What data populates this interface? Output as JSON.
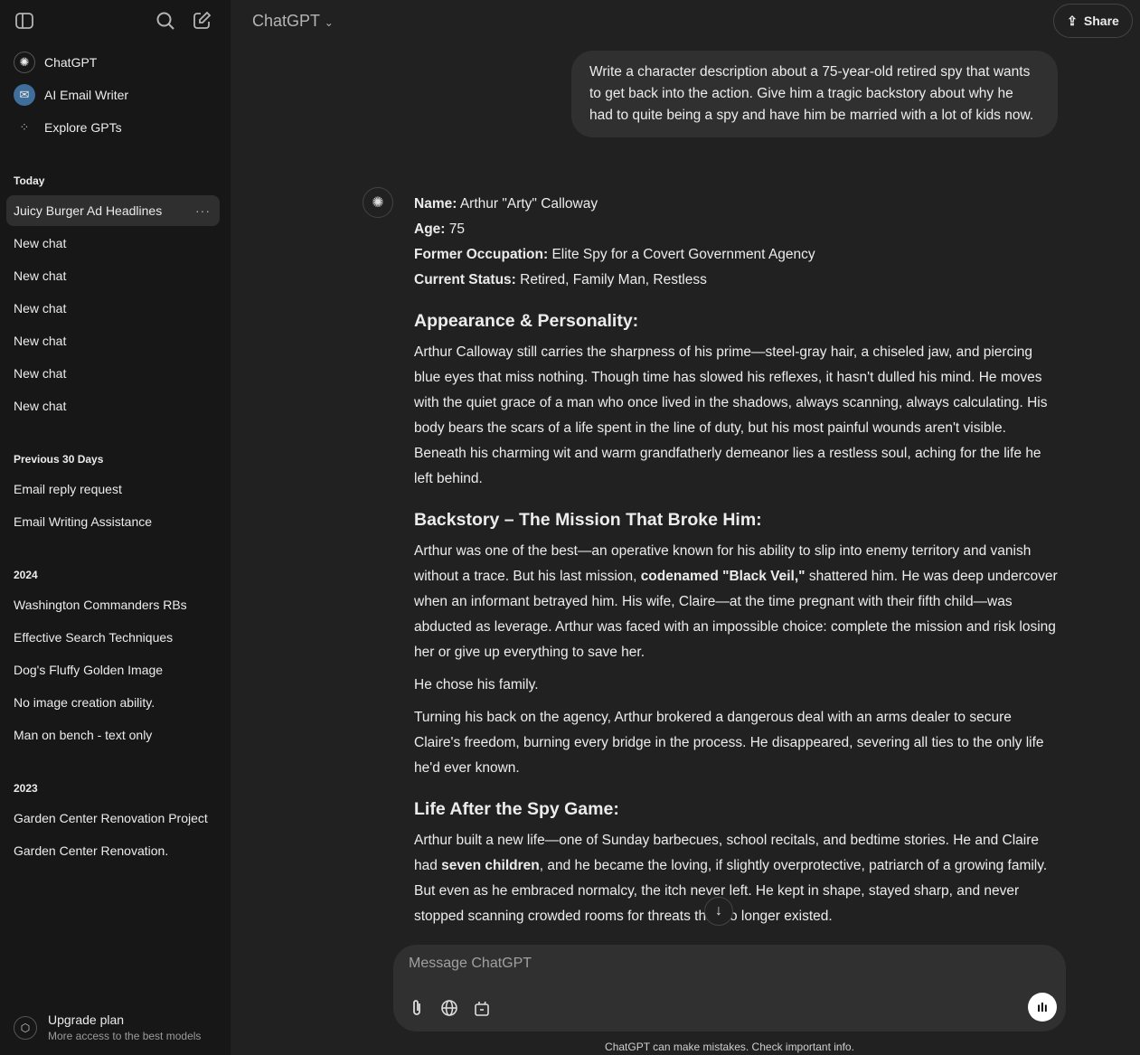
{
  "sidebar": {
    "gpts": [
      {
        "label": "ChatGPT",
        "icon": "openai-logo-icon"
      },
      {
        "label": "AI Email Writer",
        "icon": "email-gpt-avatar"
      },
      {
        "label": "Explore GPTs",
        "icon": "grid-icon"
      }
    ],
    "sections": [
      {
        "title": "Today",
        "items": [
          "Juicy Burger Ad Headlines",
          "New chat",
          "New chat",
          "New chat",
          "New chat",
          "New chat",
          "New chat"
        ]
      },
      {
        "title": "Previous 30 Days",
        "items": [
          "Email reply request",
          "Email Writing Assistance"
        ]
      },
      {
        "title": "2024",
        "items": [
          "Washington Commanders RBs",
          "Effective Search Techniques",
          "Dog's Fluffy Golden Image",
          "No image creation ability.",
          "Man on bench - text only"
        ]
      },
      {
        "title": "2023",
        "items": [
          "Garden Center Renovation Project",
          "Garden Center Renovation."
        ]
      }
    ],
    "upgrade": {
      "title": "Upgrade plan",
      "subtitle": "More access to the best models"
    }
  },
  "header": {
    "title": "ChatGPT",
    "share": "Share"
  },
  "user_message": "Write a character description about a 75-year-old retired spy that wants to get back into the action. Give him a tragic backstory about why he had to quite being a spy and have him be married with a lot of kids now.",
  "response": {
    "fields": [
      {
        "k": "Name:",
        "v": " Arthur \"Arty\" Calloway"
      },
      {
        "k": "Age:",
        "v": " 75"
      },
      {
        "k": "Former Occupation:",
        "v": " Elite Spy for a Covert Government Agency"
      },
      {
        "k": "Current Status:",
        "v": " Retired, Family Man, Restless"
      }
    ],
    "h1": "Appearance & Personality:",
    "p1": "Arthur Calloway still carries the sharpness of his prime—steel-gray hair, a chiseled jaw, and piercing blue eyes that miss nothing. Though time has slowed his reflexes, it hasn't dulled his mind. He moves with the quiet grace of a man who once lived in the shadows, always scanning, always calculating. His body bears the scars of a life spent in the line of duty, but his most painful wounds aren't visible. Beneath his charming wit and warm grandfatherly demeanor lies a restless soul, aching for the life he left behind.",
    "h2": "Backstory – The Mission That Broke Him:",
    "p2a": "Arthur was one of the best—an operative known for his ability to slip into enemy territory and vanish without a trace. But his last mission, ",
    "p2b": "codenamed \"Black Veil,\"",
    "p2c": " shattered him. He was deep undercover when an informant betrayed him. His wife, Claire—at the time pregnant with their fifth child—was abducted as leverage. Arthur was faced with an impossible choice: complete the mission and risk losing her or give up everything to save her.",
    "p3": "He chose his family.",
    "p4": "Turning his back on the agency, Arthur brokered a dangerous deal with an arms dealer to secure Claire's freedom, burning every bridge in the process. He disappeared, severing all ties to the only life he'd ever known.",
    "h3": "Life After the Spy Game:",
    "p5a": "Arthur built a new life—one of Sunday barbecues, school recitals, and bedtime stories. He and Claire had ",
    "p5b": "seven children",
    "p5c": ", and he became the loving, if slightly overprotective, patriarch of a growing family. But even as he embraced normalcy, the itch never left. He kept in shape, stayed sharp, and never stopped scanning crowded rooms for threats that no longer existed."
  },
  "composer": {
    "placeholder": "Message ChatGPT"
  },
  "disclaimer": "ChatGPT can make mistakes. Check important info."
}
